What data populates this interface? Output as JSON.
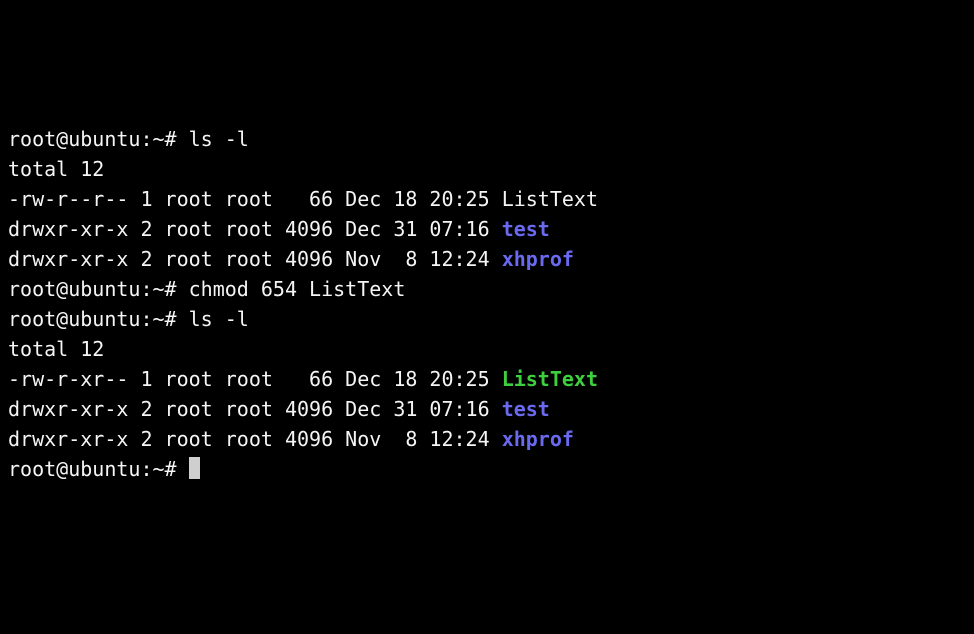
{
  "session": {
    "prompt": "root@ubuntu:~#",
    "commands": {
      "ls_l": "ls -l",
      "chmod": "chmod 654 ListText"
    },
    "listing1": {
      "total": "total 12",
      "rows": [
        {
          "perms": "-rw-r--r--",
          "links": "1",
          "owner": "root",
          "group": "root",
          "size": "  66",
          "month": "Dec",
          "day": "18",
          "time": "20:25",
          "name": "ListText",
          "type": "file"
        },
        {
          "perms": "drwxr-xr-x",
          "links": "2",
          "owner": "root",
          "group": "root",
          "size": "4096",
          "month": "Dec",
          "day": "31",
          "time": "07:16",
          "name": "test",
          "type": "dir"
        },
        {
          "perms": "drwxr-xr-x",
          "links": "2",
          "owner": "root",
          "group": "root",
          "size": "4096",
          "month": "Nov",
          "day": " 8",
          "time": "12:24",
          "name": "xhprof",
          "type": "dir"
        }
      ]
    },
    "listing2": {
      "total": "total 12",
      "rows": [
        {
          "perms": "-rw-r-xr--",
          "links": "1",
          "owner": "root",
          "group": "root",
          "size": "  66",
          "month": "Dec",
          "day": "18",
          "time": "20:25",
          "name": "ListText",
          "type": "exec"
        },
        {
          "perms": "drwxr-xr-x",
          "links": "2",
          "owner": "root",
          "group": "root",
          "size": "4096",
          "month": "Dec",
          "day": "31",
          "time": "07:16",
          "name": "test",
          "type": "dir"
        },
        {
          "perms": "drwxr-xr-x",
          "links": "2",
          "owner": "root",
          "group": "root",
          "size": "4096",
          "month": "Nov",
          "day": " 8",
          "time": "12:24",
          "name": "xhprof",
          "type": "dir"
        }
      ]
    }
  }
}
